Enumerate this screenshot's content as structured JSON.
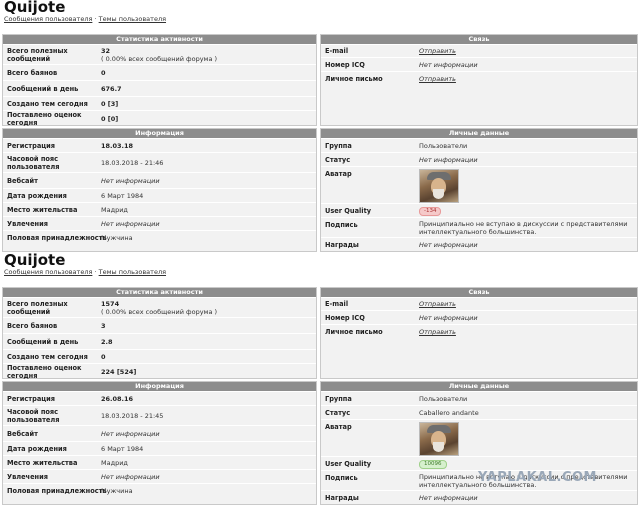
{
  "profiles": [
    {
      "username": "Quijote",
      "breadcrumb": {
        "link1": "Сообщения пользователя",
        "sep": "·",
        "link2": "Темы пользователя"
      },
      "activity": {
        "title": "Статистика активности",
        "posts_label": "Всего полезных сообщений",
        "posts_value": "32",
        "posts_pct": "( 0.00% всех сообщений форума )",
        "bans_label": "Всего баянов",
        "bans_value": "0",
        "perday_label": "Сообщений в день",
        "perday_value": "676.7",
        "topics_label": "Создано тем сегодня",
        "topics_value": "0 [3]",
        "ratings_label": "Поставлено оценок сегодня",
        "ratings_value": "0 [0]"
      },
      "contact": {
        "title": "Связь",
        "email_label": "E-mail",
        "email_value": "Отправить",
        "icq_label": "Номер ICQ",
        "icq_value": "Нет информации",
        "pm_label": "Личное письмо",
        "pm_value": "Отправить"
      },
      "info": {
        "title": "Информация",
        "reg_label": "Регистрация",
        "reg_value": "18.03.18",
        "tz_label": "Часовой пояс пользователя",
        "tz_value": "18.03.2018 - 21:46",
        "site_label": "Вебсайт",
        "site_value": "Нет информации",
        "dob_label": "Дата рождения",
        "dob_value": "6 Март 1984",
        "loc_label": "Место жительства",
        "loc_value": "Мадрид",
        "hobby_label": "Увлечения",
        "hobby_value": "Нет информации",
        "gender_label": "Половая принадлежность",
        "gender_value": "Мужчина"
      },
      "personal": {
        "title": "Личные данные",
        "group_label": "Группа",
        "group_value": "Пользователи",
        "status_label": "Статус",
        "status_value": "Нет информации",
        "avatar_label": "Аватар",
        "quality_label": "User Quality",
        "quality_value": "-134",
        "quality_color": "#f5c9c9",
        "sig_label": "Подпись",
        "sig_value": "Принципиально не вступаю в дискуссии с представителями интеллектуального большинства.",
        "awards_label": "Награды",
        "awards_value": "Нет информации"
      }
    },
    {
      "username": "Quijote",
      "breadcrumb": {
        "link1": "Сообщения пользователя",
        "sep": "·",
        "link2": "Темы пользователя"
      },
      "activity": {
        "title": "Статистика активности",
        "posts_label": "Всего полезных сообщений",
        "posts_value": "1574",
        "posts_pct": "( 0.00% всех сообщений форума )",
        "bans_label": "Всего баянов",
        "bans_value": "3",
        "perday_label": "Сообщений в день",
        "perday_value": "2.8",
        "topics_label": "Создано тем сегодня",
        "topics_value": "0",
        "ratings_label": "Поставлено оценок сегодня",
        "ratings_value": "224 [524]"
      },
      "contact": {
        "title": "Связь",
        "email_label": "E-mail",
        "email_value": "Отправить",
        "icq_label": "Номер ICQ",
        "icq_value": "Нет информации",
        "pm_label": "Личное письмо",
        "pm_value": "Отправить"
      },
      "info": {
        "title": "Информация",
        "reg_label": "Регистрация",
        "reg_value": "26.08.16",
        "tz_label": "Часовой пояс пользователя",
        "tz_value": "18.03.2018 - 21:45",
        "site_label": "Вебсайт",
        "site_value": "Нет информации",
        "dob_label": "Дата рождения",
        "dob_value": "6 Март 1984",
        "loc_label": "Место жительства",
        "loc_value": "Мадрид",
        "hobby_label": "Увлечения",
        "hobby_value": "Нет информации",
        "gender_label": "Половая принадлежность",
        "gender_value": "Мужчина"
      },
      "personal": {
        "title": "Личные данные",
        "group_label": "Группа",
        "group_value": "Пользователи",
        "status_label": "Статус",
        "status_value": "Caballero andante",
        "avatar_label": "Аватар",
        "quality_label": "User Quality",
        "quality_value": "10096",
        "quality_color": "#d6f0cd",
        "sig_label": "Подпись",
        "sig_value": "Принципиально не вступаю в дискуссии с представителями интеллектуального большинства.",
        "awards_label": "Награды",
        "awards_value": "Нет информации"
      }
    }
  ],
  "watermark": "YAPLAKAL.COM"
}
